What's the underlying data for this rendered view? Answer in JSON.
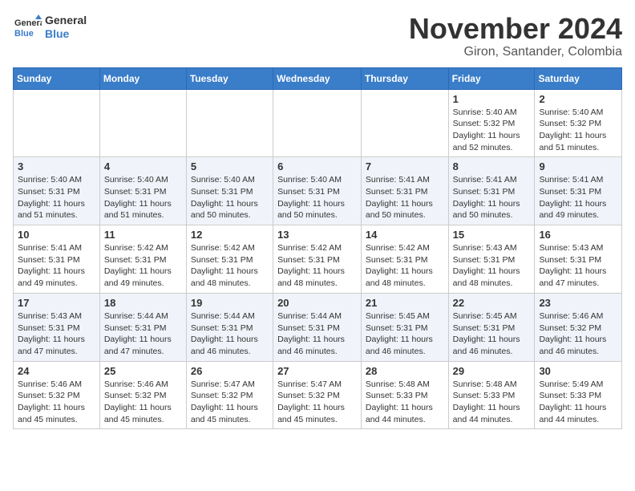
{
  "header": {
    "logo_line1": "General",
    "logo_line2": "Blue",
    "title": "November 2024",
    "subtitle": "Giron, Santander, Colombia"
  },
  "calendar": {
    "weekdays": [
      "Sunday",
      "Monday",
      "Tuesday",
      "Wednesday",
      "Thursday",
      "Friday",
      "Saturday"
    ],
    "weeks": [
      [
        {
          "day": "",
          "info": ""
        },
        {
          "day": "",
          "info": ""
        },
        {
          "day": "",
          "info": ""
        },
        {
          "day": "",
          "info": ""
        },
        {
          "day": "",
          "info": ""
        },
        {
          "day": "1",
          "info": "Sunrise: 5:40 AM\nSunset: 5:32 PM\nDaylight: 11 hours and 52 minutes."
        },
        {
          "day": "2",
          "info": "Sunrise: 5:40 AM\nSunset: 5:32 PM\nDaylight: 11 hours and 51 minutes."
        }
      ],
      [
        {
          "day": "3",
          "info": "Sunrise: 5:40 AM\nSunset: 5:31 PM\nDaylight: 11 hours and 51 minutes."
        },
        {
          "day": "4",
          "info": "Sunrise: 5:40 AM\nSunset: 5:31 PM\nDaylight: 11 hours and 51 minutes."
        },
        {
          "day": "5",
          "info": "Sunrise: 5:40 AM\nSunset: 5:31 PM\nDaylight: 11 hours and 50 minutes."
        },
        {
          "day": "6",
          "info": "Sunrise: 5:40 AM\nSunset: 5:31 PM\nDaylight: 11 hours and 50 minutes."
        },
        {
          "day": "7",
          "info": "Sunrise: 5:41 AM\nSunset: 5:31 PM\nDaylight: 11 hours and 50 minutes."
        },
        {
          "day": "8",
          "info": "Sunrise: 5:41 AM\nSunset: 5:31 PM\nDaylight: 11 hours and 50 minutes."
        },
        {
          "day": "9",
          "info": "Sunrise: 5:41 AM\nSunset: 5:31 PM\nDaylight: 11 hours and 49 minutes."
        }
      ],
      [
        {
          "day": "10",
          "info": "Sunrise: 5:41 AM\nSunset: 5:31 PM\nDaylight: 11 hours and 49 minutes."
        },
        {
          "day": "11",
          "info": "Sunrise: 5:42 AM\nSunset: 5:31 PM\nDaylight: 11 hours and 49 minutes."
        },
        {
          "day": "12",
          "info": "Sunrise: 5:42 AM\nSunset: 5:31 PM\nDaylight: 11 hours and 48 minutes."
        },
        {
          "day": "13",
          "info": "Sunrise: 5:42 AM\nSunset: 5:31 PM\nDaylight: 11 hours and 48 minutes."
        },
        {
          "day": "14",
          "info": "Sunrise: 5:42 AM\nSunset: 5:31 PM\nDaylight: 11 hours and 48 minutes."
        },
        {
          "day": "15",
          "info": "Sunrise: 5:43 AM\nSunset: 5:31 PM\nDaylight: 11 hours and 48 minutes."
        },
        {
          "day": "16",
          "info": "Sunrise: 5:43 AM\nSunset: 5:31 PM\nDaylight: 11 hours and 47 minutes."
        }
      ],
      [
        {
          "day": "17",
          "info": "Sunrise: 5:43 AM\nSunset: 5:31 PM\nDaylight: 11 hours and 47 minutes."
        },
        {
          "day": "18",
          "info": "Sunrise: 5:44 AM\nSunset: 5:31 PM\nDaylight: 11 hours and 47 minutes."
        },
        {
          "day": "19",
          "info": "Sunrise: 5:44 AM\nSunset: 5:31 PM\nDaylight: 11 hours and 46 minutes."
        },
        {
          "day": "20",
          "info": "Sunrise: 5:44 AM\nSunset: 5:31 PM\nDaylight: 11 hours and 46 minutes."
        },
        {
          "day": "21",
          "info": "Sunrise: 5:45 AM\nSunset: 5:31 PM\nDaylight: 11 hours and 46 minutes."
        },
        {
          "day": "22",
          "info": "Sunrise: 5:45 AM\nSunset: 5:31 PM\nDaylight: 11 hours and 46 minutes."
        },
        {
          "day": "23",
          "info": "Sunrise: 5:46 AM\nSunset: 5:32 PM\nDaylight: 11 hours and 46 minutes."
        }
      ],
      [
        {
          "day": "24",
          "info": "Sunrise: 5:46 AM\nSunset: 5:32 PM\nDaylight: 11 hours and 45 minutes."
        },
        {
          "day": "25",
          "info": "Sunrise: 5:46 AM\nSunset: 5:32 PM\nDaylight: 11 hours and 45 minutes."
        },
        {
          "day": "26",
          "info": "Sunrise: 5:47 AM\nSunset: 5:32 PM\nDaylight: 11 hours and 45 minutes."
        },
        {
          "day": "27",
          "info": "Sunrise: 5:47 AM\nSunset: 5:32 PM\nDaylight: 11 hours and 45 minutes."
        },
        {
          "day": "28",
          "info": "Sunrise: 5:48 AM\nSunset: 5:33 PM\nDaylight: 11 hours and 44 minutes."
        },
        {
          "day": "29",
          "info": "Sunrise: 5:48 AM\nSunset: 5:33 PM\nDaylight: 11 hours and 44 minutes."
        },
        {
          "day": "30",
          "info": "Sunrise: 5:49 AM\nSunset: 5:33 PM\nDaylight: 11 hours and 44 minutes."
        }
      ]
    ]
  }
}
